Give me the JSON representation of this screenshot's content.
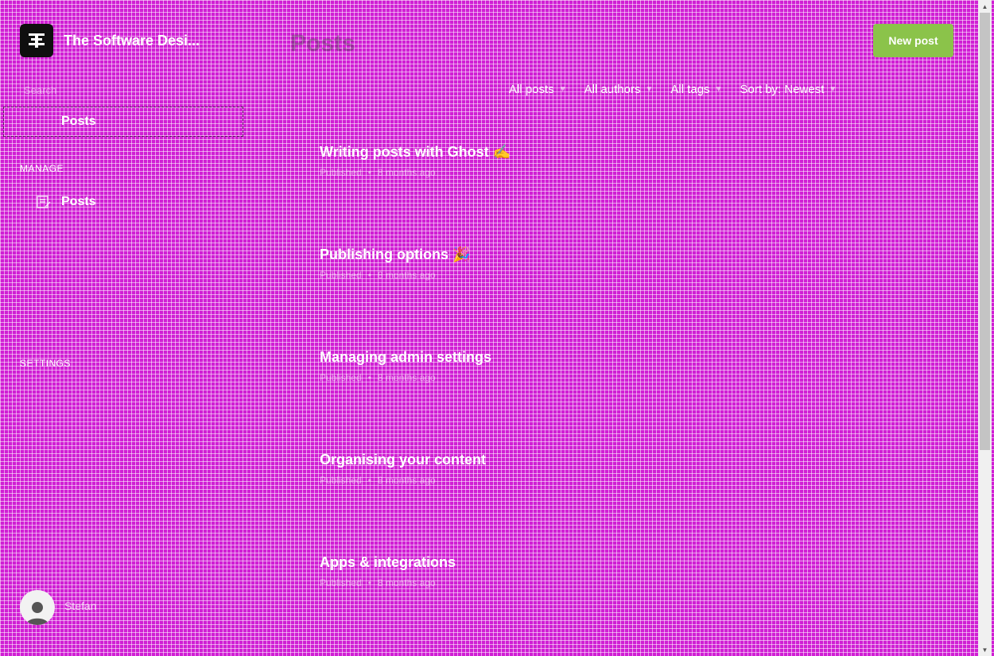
{
  "sidebar": {
    "site_name": "The Software Desi...",
    "top_label": "Search",
    "selected_item": "Posts",
    "manage_heading": "MANAGE",
    "manage_posts_label": "Posts",
    "settings_heading": "SETTINGS",
    "user": {
      "name": "Stefan",
      "email": ""
    }
  },
  "header": {
    "title": "Posts",
    "new_post_label": "New post"
  },
  "filters": [
    {
      "label": "All posts"
    },
    {
      "label": "All authors"
    },
    {
      "label": "All tags"
    },
    {
      "label": "Sort by: Newest"
    }
  ],
  "posts": [
    {
      "title": "Writing posts with Ghost ✍️",
      "status": "Published",
      "time": "8 months ago"
    },
    {
      "title": "Publishing options 🎉",
      "status": "Published",
      "time": "8 months ago"
    },
    {
      "title": "Managing admin settings",
      "status": "Published",
      "time": "8 months ago"
    },
    {
      "title": "Organising your content",
      "status": "Published",
      "time": "8 months ago"
    },
    {
      "title": "Apps & integrations",
      "status": "Published",
      "time": "8 months ago"
    }
  ],
  "colors": {
    "background": "#d01fd4",
    "accent_button": "#8bc34a"
  }
}
